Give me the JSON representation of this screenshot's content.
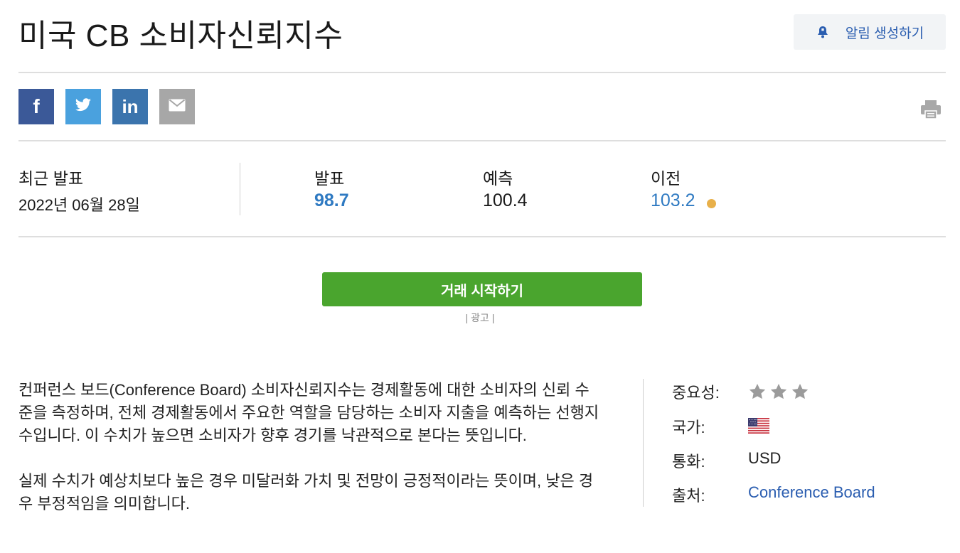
{
  "page": {
    "title": "미국 CB 소비자신뢰지수",
    "alert_button": {
      "label": "알림 생성하기",
      "icon": "bell-icon"
    }
  },
  "share": [
    {
      "name": "facebook",
      "glyph": "f",
      "color": "#3b5998"
    },
    {
      "name": "twitter",
      "glyph": "",
      "color": "#4aa1de"
    },
    {
      "name": "linkedin",
      "glyph": "in",
      "color": "#3b74ad"
    },
    {
      "name": "email",
      "glyph": "",
      "color": "#a7a7a7"
    }
  ],
  "release": {
    "latest_label": "최근 발표",
    "latest_date": "2022년 06월 28일",
    "actual": {
      "label": "발표",
      "value": "98.7",
      "color": "#2f7ac2"
    },
    "forecast": {
      "label": "예측",
      "value": "100.4"
    },
    "previous": {
      "label": "이전",
      "value": "103.2",
      "color": "#2f7ac2",
      "status_dot_color": "#e8b04a"
    }
  },
  "cta": {
    "label": "거래 시작하기",
    "ad_label": "| 광고 |",
    "color": "#4aa52e"
  },
  "description": [
    "컨퍼런스 보드(Conference Board) 소비자신뢰지수는 경제활동에 대한 소비자의 신뢰 수준을 측정하며, 전체 경제활동에서 주요한 역할을 담당하는 소비자 지출을 예측하는 선행지수입니다. 이 수치가 높으면 소비자가 향후 경기를 낙관적으로 본다는 뜻입니다.",
    "실제 수치가 예상치보다 높은 경우 미달러화 가치 및 전망이 긍정적이라는 뜻이며, 낮은 경우 부정적임을 의미합니다."
  ],
  "info": {
    "importance": {
      "label": "중요성:",
      "stars": 3,
      "star_color": "#9b9b9b"
    },
    "country": {
      "label": "국가:",
      "flag": "us-flag-icon"
    },
    "currency": {
      "label": "통화:",
      "value": "USD"
    },
    "source": {
      "label": "출처:",
      "value": "Conference Board",
      "color": "#2a5db0"
    }
  }
}
